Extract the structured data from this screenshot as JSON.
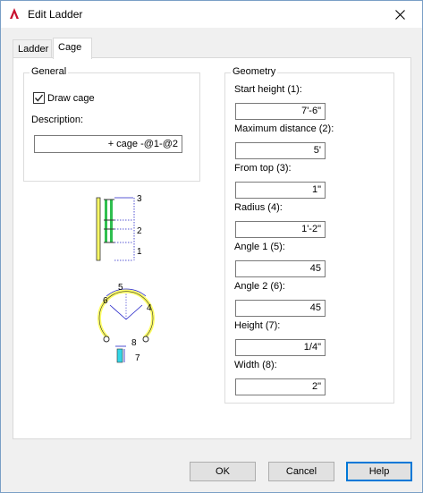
{
  "window": {
    "title": "Edit Ladder",
    "app_icon": "autocad-a-icon",
    "close_icon": "close-x-icon"
  },
  "tabs": [
    {
      "label": "Ladder",
      "active": false
    },
    {
      "label": "Cage",
      "active": true
    }
  ],
  "general": {
    "label": "General",
    "draw_cage_label": "Draw cage",
    "draw_cage_checked": true,
    "description_label": "Description:",
    "description_value": "+ cage -@1-@2"
  },
  "geometry": {
    "label": "Geometry",
    "fields": [
      {
        "label": "Start height (1):",
        "value": "7'-6\""
      },
      {
        "label": "Maximum distance (2):",
        "value": "5'"
      },
      {
        "label": "From top (3):",
        "value": "1\""
      },
      {
        "label": "Radius (4):",
        "value": "1'-2\""
      },
      {
        "label": "Angle 1 (5):",
        "value": "45"
      },
      {
        "label": "Angle 2 (6):",
        "value": "45"
      },
      {
        "label": "Height (7):",
        "value": "1/4\""
      },
      {
        "label": "Width (8):",
        "value": "2\""
      }
    ]
  },
  "diagram": {
    "side_labels": [
      "3",
      "2",
      "1"
    ],
    "top_labels": [
      "5",
      "6",
      "4",
      "8",
      "7"
    ]
  },
  "buttons": {
    "ok": "OK",
    "cancel": "Cancel",
    "help": "Help"
  },
  "colors": {
    "accent": "#0078d7",
    "cage_yellow": "#ffff66",
    "cage_green": "#2fbf4f",
    "dim_blue": "#2323c8"
  }
}
